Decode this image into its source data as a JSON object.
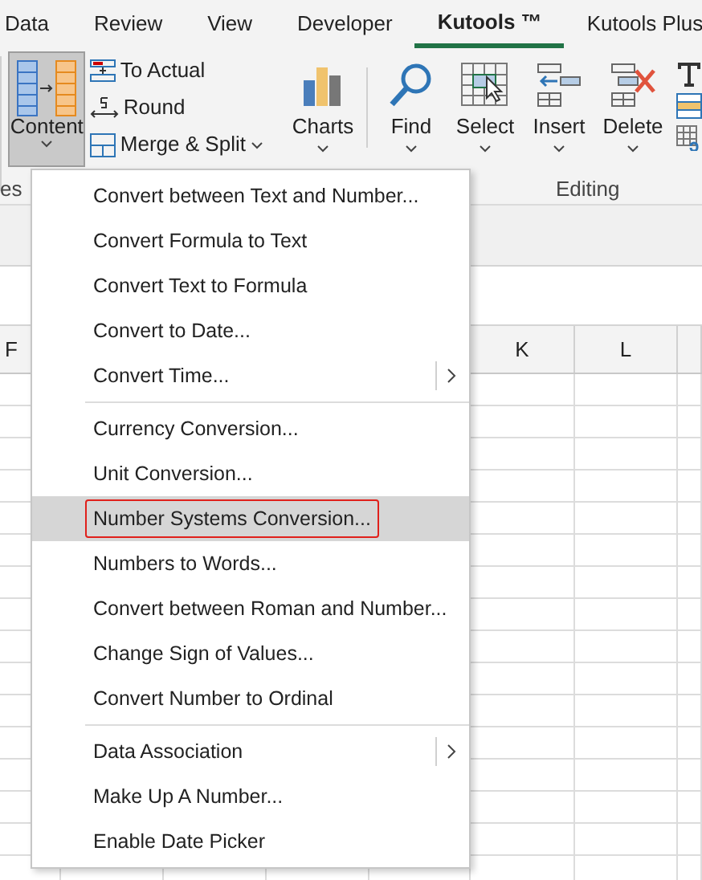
{
  "tabs": [
    {
      "label": "Data",
      "selected": false
    },
    {
      "label": "Review",
      "selected": false
    },
    {
      "label": "View",
      "selected": false
    },
    {
      "label": "Developer",
      "selected": false
    },
    {
      "label": "Kutools ™",
      "selected": true
    },
    {
      "label": "Kutools Plus",
      "selected": false
    }
  ],
  "ribbon": {
    "content_button": {
      "label": "Content",
      "pressed": true
    },
    "small_buttons": [
      {
        "label": "To Actual",
        "dropdown": false
      },
      {
        "label": "Round",
        "dropdown": false
      },
      {
        "label": "Merge & Split",
        "dropdown": true
      }
    ],
    "large_buttons": [
      {
        "kind": "charts",
        "label": "Charts"
      },
      {
        "kind": "find",
        "label": "Find"
      },
      {
        "kind": "select",
        "label": "Select"
      },
      {
        "kind": "insert",
        "label": "Insert"
      },
      {
        "kind": "delete",
        "label": "Delete"
      }
    ],
    "group_labels": [
      "es",
      "Editing"
    ]
  },
  "columns": [
    "F",
    "K",
    "L"
  ],
  "menu": {
    "groups": [
      [
        {
          "label": "Convert between Text and Number...",
          "submenu": false,
          "selected": false
        },
        {
          "label": "Convert Formula to Text",
          "submenu": false,
          "selected": false
        },
        {
          "label": "Convert Text to Formula",
          "submenu": false,
          "selected": false
        },
        {
          "label": "Convert to Date...",
          "submenu": false,
          "selected": false
        },
        {
          "label": "Convert Time...",
          "submenu": true,
          "selected": false
        }
      ],
      [
        {
          "label": "Currency Conversion...",
          "submenu": false,
          "selected": false
        },
        {
          "label": "Unit Conversion...",
          "submenu": false,
          "selected": false
        },
        {
          "label": "Number Systems Conversion...",
          "submenu": false,
          "selected": true
        },
        {
          "label": "Numbers to Words...",
          "submenu": false,
          "selected": false
        },
        {
          "label": "Convert between Roman and Number...",
          "submenu": false,
          "selected": false
        },
        {
          "label": "Change Sign of Values...",
          "submenu": false,
          "selected": false
        },
        {
          "label": "Convert Number to Ordinal",
          "submenu": false,
          "selected": false
        }
      ],
      [
        {
          "label": "Data Association",
          "submenu": true,
          "selected": false
        },
        {
          "label": "Make Up A Number...",
          "submenu": false,
          "selected": false
        },
        {
          "label": "Enable Date Picker",
          "submenu": false,
          "selected": false
        }
      ]
    ]
  }
}
